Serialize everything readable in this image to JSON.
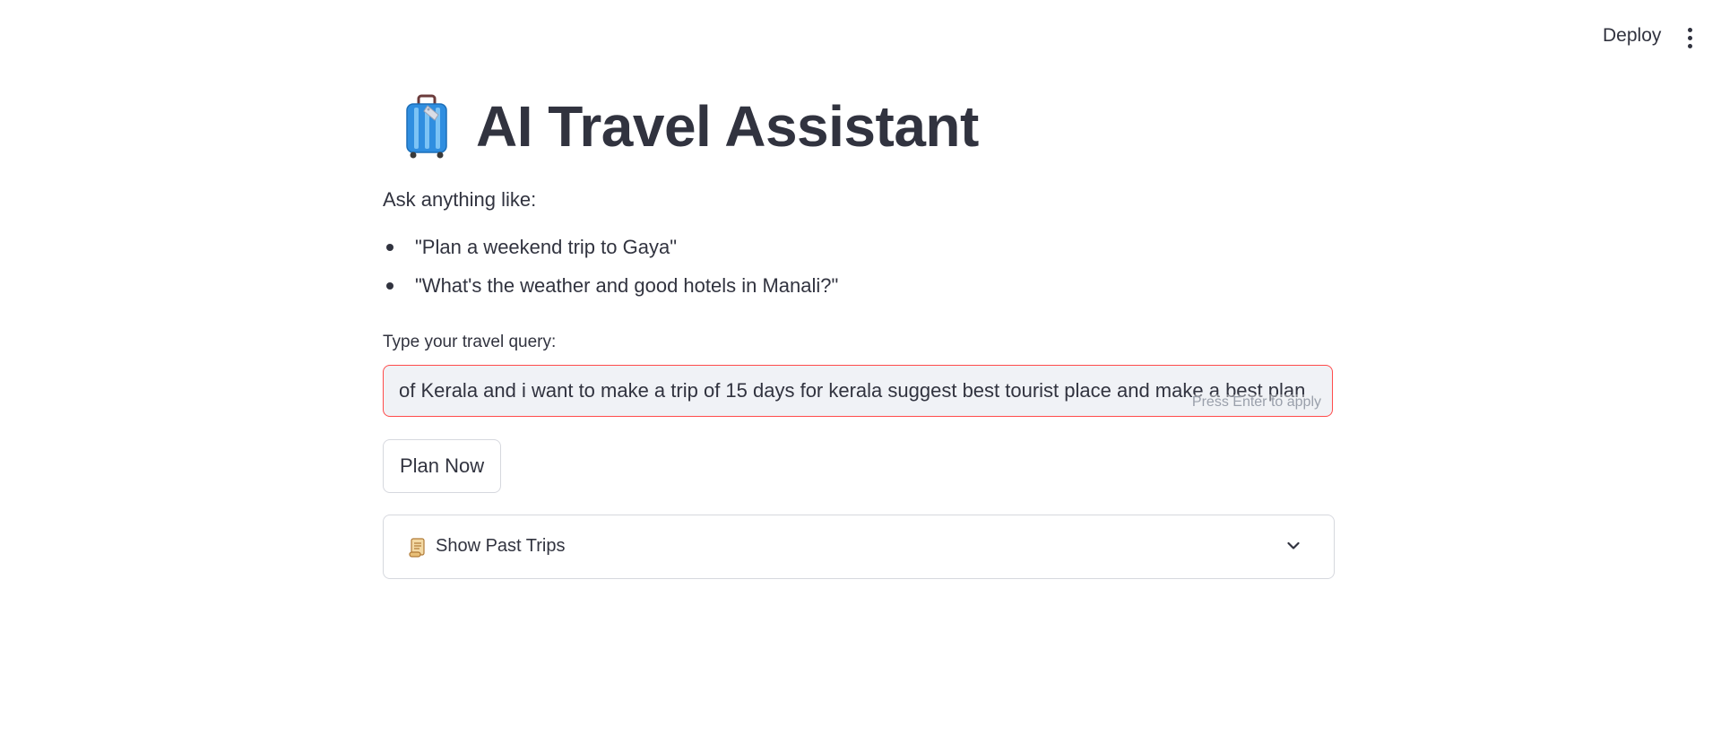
{
  "header": {
    "deploy_label": "Deploy",
    "menu_icon": "vertical-ellipsis-icon"
  },
  "main": {
    "title_icon": "luggage-icon",
    "title": "AI Travel Assistant",
    "subtitle": "Ask anything like:",
    "examples": [
      "\"Plan a weekend trip to Gaya\"",
      "\"What's the weather and good hotels in Manali?\""
    ],
    "query": {
      "label": "Type your travel query:",
      "value": "of Kerala and i want to make a trip of 15 days for kerala suggest best tourist place and make a best plan",
      "hint": "Press Enter to apply"
    },
    "plan_button_label": "Plan Now",
    "expander": {
      "icon": "scroll-icon",
      "label": "Show Past Trips",
      "state": "collapsed"
    }
  },
  "colors": {
    "text": "#31333f",
    "input_background": "#f0f2f6",
    "input_border_focus": "#ff4b4b",
    "border": "#d6d8de",
    "hint": "#9aa0ab",
    "luggage_blue": "#2f8ee0"
  }
}
